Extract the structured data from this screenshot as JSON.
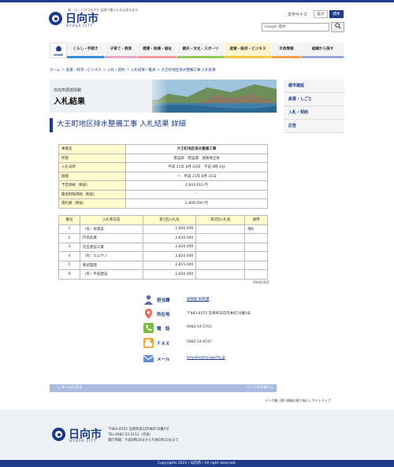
{
  "header": {
    "tagline": "海・山・人がつながり 笑顔で暮らせる元気なまち",
    "logo_text": "日向市",
    "logo_sub": "HYUGA CITY",
    "font_size_label": "文字サイズ",
    "font_size_large": "拡大",
    "font_size_standard": "標準",
    "search_placeholder": "Google 提供"
  },
  "gnav": {
    "home": "HOME",
    "items": [
      "くらし・手続き",
      "子育て・教育",
      "健康・医療・福祉",
      "観光・文化・スポーツ",
      "産業・経済・ビジネス",
      "市政情報",
      "組織から探す"
    ]
  },
  "breadcrumb": "ホーム ＞ 産業・経済・ビジネス ＞ 入札・契約 ＞ 入札結果一覧表 ＞ 大王町地区排水整備工事 入札結果",
  "banner": {
    "subtitle": "日向市調達情報",
    "title": "入札結果"
  },
  "sidebar": [
    "都市建設",
    "産業・しごと",
    "入札・契約",
    "広告"
  ],
  "page_title": "大王町地区排水整備工事 入札結果 詳細",
  "info_table": [
    {
      "k": "事業名",
      "v": "大王町地区排水整備工事"
    },
    {
      "k": "所管",
      "v": "建設部　建設課　道路保全係"
    },
    {
      "k": "入札日時",
      "v": "平成 21年 8月 24日　午前 9時 0分"
    },
    {
      "k": "期間",
      "v": "～　平成 21年 8月 31日"
    },
    {
      "k": "予定価格（税抜）",
      "v": "2,843,610 円"
    },
    {
      "k": "最低制限価格（税抜）",
      "v": "--"
    },
    {
      "k": "落札額（税抜）",
      "v": "2,800,000 円"
    }
  ],
  "bid_table": {
    "headers": [
      "番号",
      "入札者氏名",
      "第1回入札高",
      "第2回入札高",
      "適用"
    ],
    "rows": [
      [
        "1",
        "（有）寿建設",
        "2,800,000",
        "",
        "落札"
      ],
      [
        "2",
        "戸高産業",
        "2,830,000",
        "",
        ""
      ],
      [
        "3",
        "児玉建設工業",
        "2,820,000",
        "",
        ""
      ],
      [
        "4",
        "（有）エムサン",
        "2,820,000",
        "",
        ""
      ],
      [
        "5",
        "東武開発",
        "2,815,000",
        "",
        ""
      ],
      [
        "6",
        "（有）平成建設",
        "2,820,000",
        "",
        ""
      ]
    ]
  },
  "page_code": "0906240Z",
  "contact": {
    "tanto_label": "担当課",
    "tanto_value": "総務部 財政課",
    "address_label": "所在地",
    "address_value": "〒883-8555 宮崎県日向市本町10番5号",
    "phone_label": "電　話",
    "phone_value": "0982-54-5761",
    "fax_label": "ＦＡＸ",
    "fax_value": "0982-54-8747",
    "mail_label": "メール",
    "mail_value": "keiyaku@hyugacity.jp"
  },
  "pagebar": {
    "left": "△ ホームに戻る",
    "right": "ページの先頭へ△"
  },
  "footer_links": "リンク集 | 個人情報の取り扱い | サイトマップ",
  "footer": {
    "logo_text": "日向市",
    "logo_sub": "HYUGA CITY",
    "addr1": "〒883-8555 宮崎県日向市本町10番5号",
    "addr2": "TEL:0982-52-2111（代表）",
    "addr3": "開庁時間：午前8時30分から午後5時15分まで"
  },
  "copyright": "Copyrights 2022 / 日向市 / All right reserved."
}
